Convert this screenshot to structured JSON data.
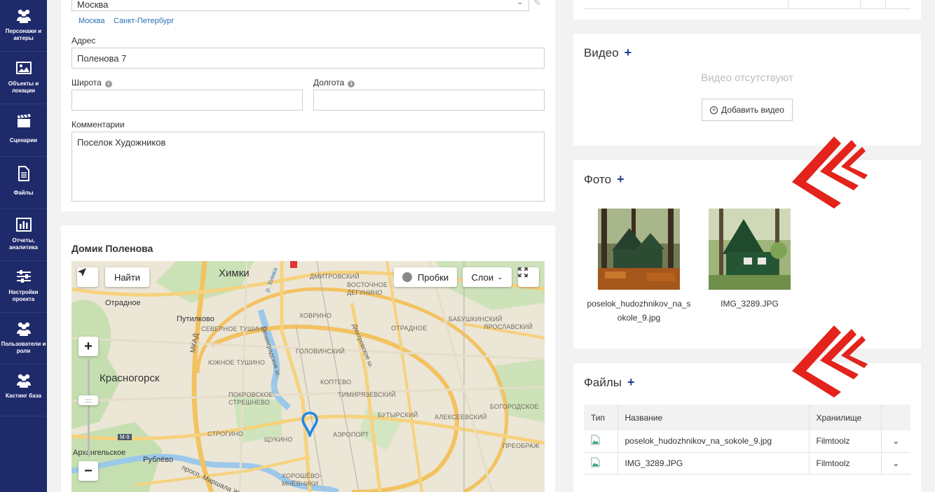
{
  "sidebar": {
    "items": [
      {
        "label": "Персонажи и актеры",
        "icon": "people-icon"
      },
      {
        "label": "Объекты и локации",
        "icon": "image-icon"
      },
      {
        "label": "Сценарии",
        "icon": "clapperboard-icon"
      },
      {
        "label": "Файлы",
        "icon": "file-icon"
      },
      {
        "label": "Отчеты, аналитика",
        "icon": "chart-icon"
      },
      {
        "label": "Настройки проекта",
        "icon": "sliders-icon"
      },
      {
        "label": "Пользователи и роли",
        "icon": "users-icon"
      },
      {
        "label": "Кастинг база",
        "icon": "casting-icon"
      }
    ]
  },
  "form": {
    "city_value": "Москва",
    "city_links": [
      "Москва",
      "Санкт-Петербург"
    ],
    "address_label": "Адрес",
    "address_value": "Поленова 7",
    "latitude_label": "Широта",
    "latitude_value": "",
    "longitude_label": "Долгота",
    "longitude_value": "",
    "comments_label": "Комментарии",
    "comments_value": "Поселок Художников"
  },
  "map_section": {
    "title": "Домик Поленова",
    "find_button": "Найти",
    "traffic_button": "Пробки",
    "layers_button": "Слои",
    "zoom_in": "+",
    "zoom_out": "−",
    "places": {
      "khimki": "Химки",
      "otradnoe_w": "Отрадное",
      "putilkovo": "Путилково",
      "sev_tushino": "СЕВЕРНОЕ ТУШИНО",
      "yuzh_tushino": "ЮЖНОЕ ТУШИНО",
      "khovrino": "ХОВРИНО",
      "golovinsky": "ГОЛОВИНСКИЙ",
      "koptevo": "КОПТЕВО",
      "timiryazevsky": "ТИМИРЯЗЕВСКИЙ",
      "dmitrovsky": "ДМИТРОВСКИЙ",
      "vost_degunino": "ВОСТОЧНОЕ ДЕГУНИНО",
      "otradnoe_e": "ОТРАДНОЕ",
      "babushkinsky": "БАБУШКИНСКИЙ",
      "yaroslavsky": "ЯРОСЛАВСКИЙ",
      "krasnogorsk": "Красногорск",
      "pokrovskoe": "ПОКРОВСКОЕ-СТРЕШНЕВО",
      "butyrsky": "БУТЫРСКИЙ",
      "alekseevsky": "АЛЕКСЕЕВСКИЙ",
      "bogorodskoe": "БОГОРОДСКОЕ",
      "strogino": "СТРОГИНО",
      "shchukino": "ЩУКИНО",
      "aeroport": "АЭРОПОРТ",
      "preobrazh": "ПРЕОБРАЖ",
      "arkhangelskoe": "Архангельское",
      "rublevo": "Рублёво",
      "khoroshevo": "ХОРОШЁВО-МНЁВНИКИ",
      "mkad": "МКАД",
      "leningradskoe": "Ленинградское ш.",
      "dmitrovskoe": "Дмитровское ш.",
      "r_khimka": "р. Химка",
      "zhukova": "просп. Маршала Жукова",
      "m9": "М-9"
    }
  },
  "video": {
    "title": "Видео",
    "empty_text": "Видео отсутствуют",
    "add_button": "Добавить видео"
  },
  "photo": {
    "title": "Фото",
    "items": [
      {
        "caption_line1": "poselok_hudozhnikov_na_s",
        "caption_line2": "okole_9.jpg"
      },
      {
        "caption_line1": "IMG_3289.JPG",
        "caption_line2": ""
      }
    ]
  },
  "files": {
    "title": "Файлы",
    "headers": {
      "type": "Тип",
      "name": "Название",
      "storage": "Хранилище"
    },
    "rows": [
      {
        "name": "poselok_hudozhnikov_na_sokole_9.jpg",
        "storage": "Filmtoolz"
      },
      {
        "name": "IMG_3289.JPG",
        "storage": "Filmtoolz"
      }
    ]
  },
  "colors": {
    "sidebar": "#1f2a6b",
    "accent": "#1f3f9a",
    "link": "#2a6fb5",
    "arrow": "#e3231c"
  }
}
